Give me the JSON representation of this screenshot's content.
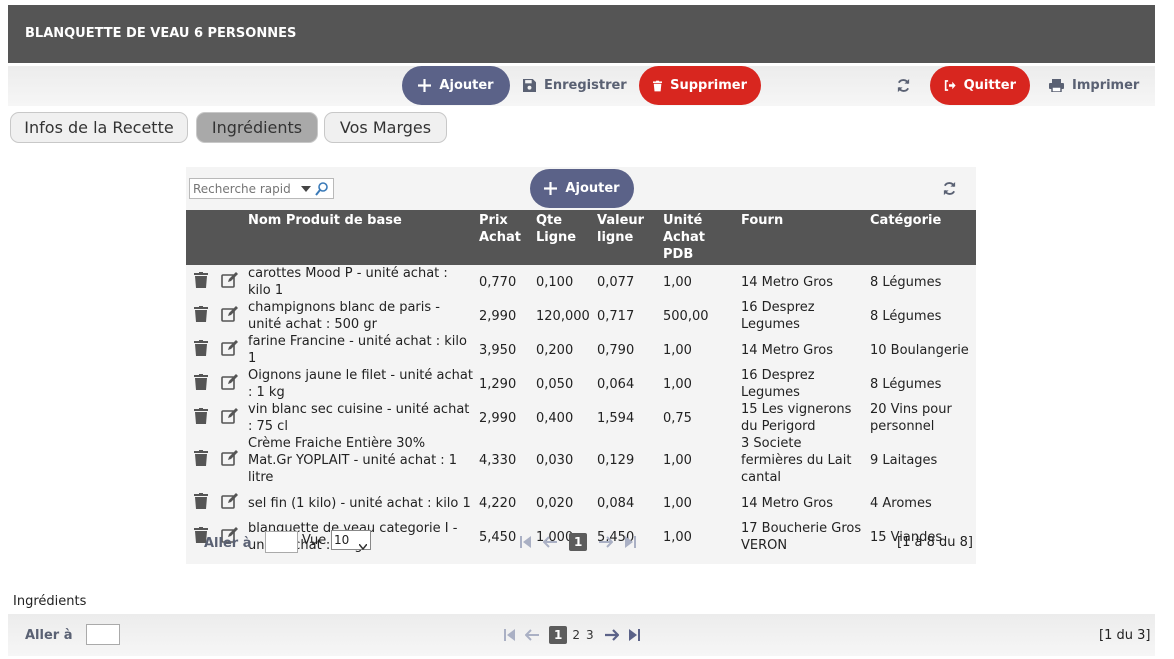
{
  "window": {
    "title": "BLANQUETTE DE VEAU 6 PERSONNES"
  },
  "toolbar": {
    "add_label": "Ajouter",
    "save_label": "Enregistrer",
    "delete_label": "Supprimer",
    "quit_label": "Quitter",
    "print_label": "Imprimer"
  },
  "tabs": [
    {
      "label": "Infos de la Recette"
    },
    {
      "label": "Ingrédients"
    },
    {
      "label": "Vos Marges"
    }
  ],
  "grid": {
    "search_placeholder": "Recherche rapide",
    "add_label": "Ajouter",
    "columns": [
      {
        "label": "Nom Produit de base"
      },
      {
        "label": "Prix Achat"
      },
      {
        "label": "Qte Ligne"
      },
      {
        "label": "Valeur ligne"
      },
      {
        "label": "Unité Achat PDB"
      },
      {
        "label": "Fourn"
      },
      {
        "label": "Catégorie"
      }
    ],
    "rows": [
      {
        "name": "carottes Mood P - unité achat : kilo 1",
        "prix": "0,770",
        "qte": "0,100",
        "valeur": "0,077",
        "unite": "1,00",
        "fourn": "14 Metro Gros",
        "categorie": "8 Légumes"
      },
      {
        "name": "champignons blanc de paris - unité achat : 500 gr",
        "prix": "2,990",
        "qte": "120,000",
        "valeur": "0,717",
        "unite": "500,00",
        "fourn": "16 Desprez Legumes",
        "categorie": "8 Légumes"
      },
      {
        "name": "farine Francine - unité achat : kilo 1",
        "prix": "3,950",
        "qte": "0,200",
        "valeur": "0,790",
        "unite": "1,00",
        "fourn": "14 Metro Gros",
        "categorie": "10 Boulangerie"
      },
      {
        "name": "Oignons jaune le filet - unité achat : 1 kg",
        "prix": "1,290",
        "qte": "0,050",
        "valeur": "0,064",
        "unite": "1,00",
        "fourn": "16 Desprez Legumes",
        "categorie": "8 Légumes"
      },
      {
        "name": "vin blanc sec cuisine - unité achat : 75 cl",
        "prix": "2,990",
        "qte": "0,400",
        "valeur": "1,594",
        "unite": "0,75",
        "fourn": "15 Les vignerons du Perigord",
        "categorie": "20 Vins pour personnel"
      },
      {
        "name": "Crème Fraiche Entière 30% Mat.Gr YOPLAIT - unité achat : 1 litre",
        "prix": "4,330",
        "qte": "0,030",
        "valeur": "0,129",
        "unite": "1,00",
        "fourn": "3 Societe fermières du Lait cantal",
        "categorie": "9 Laitages"
      },
      {
        "name": "sel fin (1 kilo) - unité achat : kilo 1",
        "prix": "4,220",
        "qte": "0,020",
        "valeur": "0,084",
        "unite": "1,00",
        "fourn": "14 Metro Gros",
        "categorie": "4 Aromes"
      },
      {
        "name": "blanquette de veau categorie I - unité achat : 1 kg",
        "prix": "5,450",
        "qte": "1,000",
        "valeur": "5,450",
        "unite": "1,00",
        "fourn": "17 Boucherie Gros VERON",
        "categorie": "15 Viandes"
      }
    ],
    "pager": {
      "goto_label": "Aller à",
      "view_label": "Vue",
      "page_size": "10",
      "current_page": "1",
      "count": "[1 à 8 du 8]"
    }
  },
  "footer": {
    "label": "Ingrédients",
    "goto_label": "Aller à",
    "pages": [
      "1",
      "2",
      "3"
    ],
    "count": "[1 du 3]"
  },
  "colors": {
    "titlebar": "#555555",
    "primary_button": "#5b6288",
    "danger_button": "#d8261f",
    "header": "#555555"
  }
}
